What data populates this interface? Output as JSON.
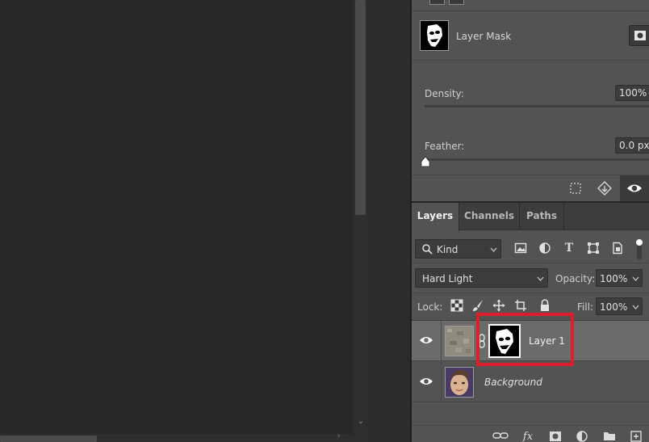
{
  "properties": {
    "mask_label": "Layer Mask",
    "density_label": "Density:",
    "density_value": "100%",
    "feather_label": "Feather:",
    "feather_value": "0.0 px"
  },
  "layers_panel": {
    "tabs": [
      {
        "label": "Layers",
        "active": true
      },
      {
        "label": "Channels",
        "active": false
      },
      {
        "label": "Paths",
        "active": false
      }
    ],
    "filter": {
      "kind_label": "Kind"
    },
    "blend_mode": "Hard Light",
    "opacity_label": "Opacity:",
    "opacity_value": "100%",
    "lock_label": "Lock:",
    "fill_label": "Fill:",
    "fill_value": "100%",
    "layers": [
      {
        "name": "Layer 1",
        "selected": true,
        "visible": true
      },
      {
        "name": "Background",
        "selected": false,
        "visible": true
      }
    ]
  },
  "colors": {
    "panel_bg": "#535353",
    "canvas_bg": "#282828",
    "selected_row": "#6b6b6b",
    "highlight": "#dd1f2c"
  },
  "icons": [
    "search-icon",
    "image-filter-icon",
    "adjustment-filter-icon",
    "type-filter-icon",
    "shape-filter-icon",
    "smart-object-filter-icon",
    "lock-transparent-icon",
    "lock-image-icon",
    "lock-position-icon",
    "lock-artboard-icon",
    "lock-all-icon",
    "eye-icon",
    "link-icon",
    "fx-icon",
    "mask-icon",
    "adjustment-icon",
    "folder-icon",
    "new-layer-icon"
  ]
}
